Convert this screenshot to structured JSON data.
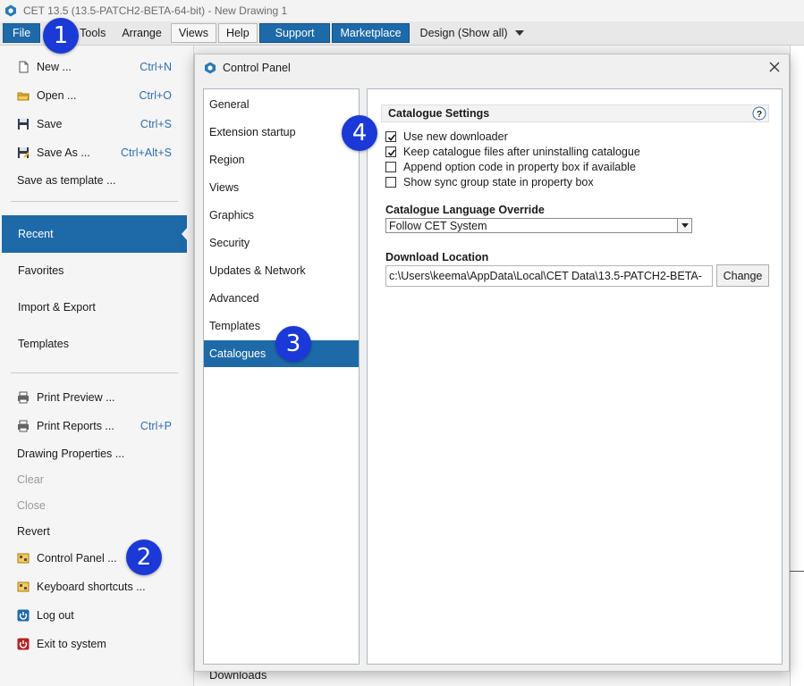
{
  "window": {
    "title": "CET 13.5 (13.5-PATCH2-BETA-64-bit) - New Drawing 1"
  },
  "menubar": {
    "items": [
      "File",
      "Tools",
      "Arrange",
      "Views",
      "Help"
    ],
    "support": "Support",
    "marketplace": "Marketplace",
    "design": "Design (Show all)"
  },
  "file_menu": {
    "top": [
      {
        "label": "New ...",
        "shortcut": "Ctrl+N",
        "icon": "new-document-icon"
      },
      {
        "label": "Open ...",
        "shortcut": "Ctrl+O",
        "icon": "open-folder-icon"
      },
      {
        "label": "Save",
        "shortcut": "Ctrl+S",
        "icon": "save-icon"
      },
      {
        "label": "Save As ...",
        "shortcut": "Ctrl+Alt+S",
        "icon": "save-as-icon"
      },
      {
        "label": "Save as template ...",
        "shortcut": ""
      }
    ],
    "sections": [
      "Recent",
      "Favorites",
      "Import & Export",
      "Templates"
    ],
    "bottom": [
      {
        "label": "Print Preview ...",
        "shortcut": "",
        "icon": "print-preview-icon"
      },
      {
        "label": "Print Reports ...",
        "shortcut": "Ctrl+P",
        "icon": "print-reports-icon"
      },
      {
        "label": "Drawing Properties ...",
        "shortcut": ""
      },
      {
        "label": "Clear",
        "shortcut": ""
      },
      {
        "label": "Close",
        "shortcut": ""
      },
      {
        "label": "Revert",
        "shortcut": ""
      },
      {
        "label": "Control Panel ...",
        "shortcut": "",
        "icon": "control-panel-icon"
      },
      {
        "label": "Keyboard shortcuts ...",
        "shortcut": "",
        "icon": "keyboard-shortcuts-icon"
      },
      {
        "label": "Log out",
        "shortcut": "",
        "icon": "log-out-icon"
      },
      {
        "label": "Exit to system",
        "shortcut": "",
        "icon": "exit-icon"
      }
    ]
  },
  "background": {
    "downloads": "Downloads"
  },
  "dialog": {
    "title": "Control Panel",
    "nav": [
      "General",
      "Extension startup",
      "Region",
      "Views",
      "Graphics",
      "Security",
      "Updates & Network",
      "Advanced",
      "Templates",
      "Catalogues"
    ],
    "selected_nav": "Catalogues",
    "section_title": "Catalogue Settings",
    "help": "?",
    "checkboxes": [
      {
        "label": "Use new downloader",
        "checked": true
      },
      {
        "label": "Keep catalogue files after uninstalling catalogue",
        "checked": true
      },
      {
        "label": "Append option code in property box if available",
        "checked": false
      },
      {
        "label": "Show sync group state in property box",
        "checked": false
      }
    ],
    "language_label": "Catalogue Language Override",
    "language_value": "Follow CET System",
    "download_label": "Download Location",
    "download_path": "c:\\Users\\keema\\AppData\\Local\\CET Data\\13.5-PATCH2-BETA-",
    "change_button": "Change"
  },
  "badges": [
    "1",
    "2",
    "3",
    "4"
  ],
  "colors": {
    "accent": "#1e6aa8",
    "badge": "#1b39d6"
  }
}
